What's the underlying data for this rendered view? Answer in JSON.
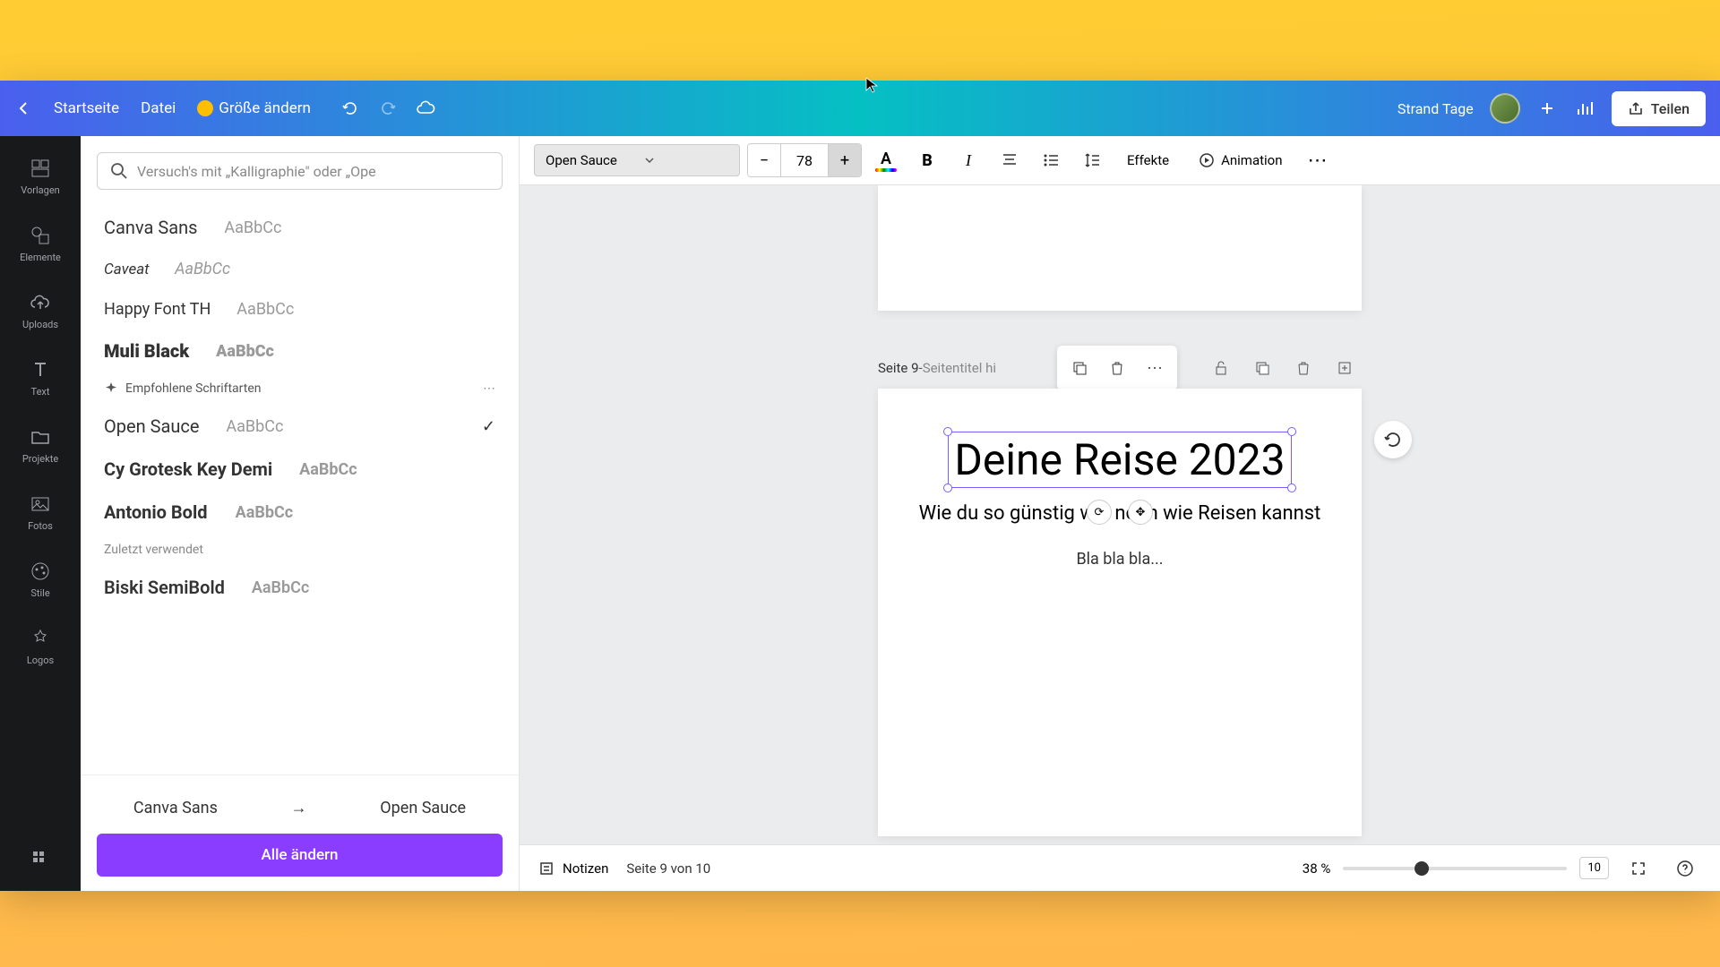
{
  "header": {
    "home": "Startseite",
    "file": "Datei",
    "resize": "Größe ändern",
    "project_name": "Strand Tage",
    "share": "Teilen"
  },
  "rail": {
    "templates": "Vorlagen",
    "elements": "Elemente",
    "uploads": "Uploads",
    "text": "Text",
    "projects": "Projekte",
    "photos": "Fotos",
    "styles": "Stile",
    "logos": "Logos"
  },
  "fonts": {
    "search_placeholder": "Versuch's mit „Kalligraphie\" oder „Ope",
    "list_top": [
      {
        "name": "Canva Sans",
        "sample": "AaBbCc"
      },
      {
        "name": "Caveat",
        "sample": "AaBbCc"
      },
      {
        "name": "Happy Font TH",
        "sample": "AaBbCc"
      },
      {
        "name": "Muli Black",
        "sample": "AaBbCc"
      }
    ],
    "recommended_label": "Empfohlene Schriftarten",
    "list_rec": [
      {
        "name": "Open Sauce",
        "sample": "AaBbCc",
        "selected": true
      },
      {
        "name": "Cy Grotesk Key Demi",
        "sample": "AaBbCc"
      },
      {
        "name": "Antonio Bold",
        "sample": "AaBbCc"
      }
    ],
    "recent_label": "Zuletzt verwendet",
    "list_recent": [
      {
        "name": "Biski SemiBold",
        "sample": "AaBbCc"
      }
    ],
    "change_from": "Canva Sans",
    "change_to": "Open Sauce",
    "apply_all": "Alle ändern"
  },
  "toolbar": {
    "font_name": "Open Sauce",
    "font_size": "78",
    "effects": "Effekte",
    "animation": "Animation"
  },
  "page": {
    "label_prefix": "Seite 9",
    "label_sep": " - ",
    "label_placeholder": "Seitentitel hi",
    "title": "Deine Reise 2023",
    "subtitle": "Wie du so günstig wie noch wie Reisen kannst",
    "body": "Bla bla bla..."
  },
  "bottom": {
    "notes": "Notizen",
    "page_counter": "Seite 9 von 10",
    "zoom": "38 %",
    "mini_pages": "10"
  }
}
